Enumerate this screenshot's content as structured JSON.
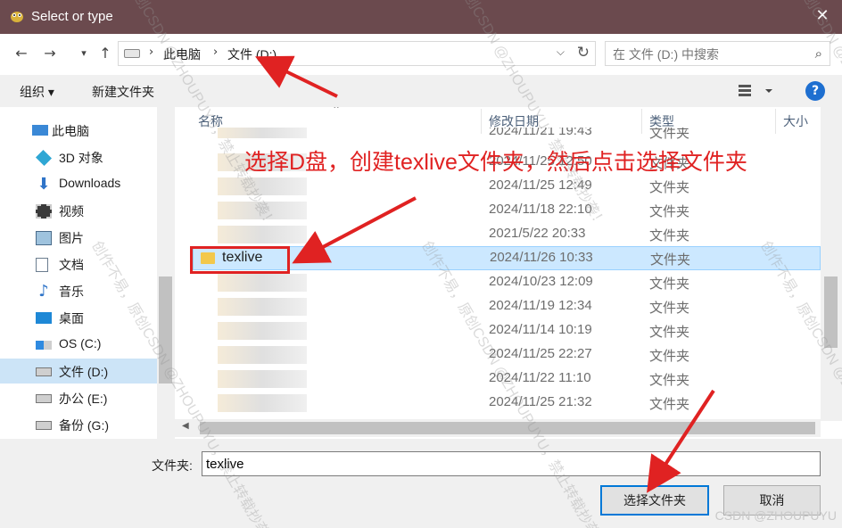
{
  "window": {
    "title": "Select or type",
    "close_glyph": "✕"
  },
  "nav": {
    "back_icon": "back-arrow-icon",
    "forward_icon": "forward-arrow-icon",
    "up_icon": "up-arrow-icon",
    "breadcrumb": [
      "此电脑",
      "文件 (D:)"
    ],
    "search_placeholder": "在 文件 (D:) 中搜索"
  },
  "toolbar": {
    "organize": "组织 ▾",
    "new_folder": "新建文件夹",
    "help": "?"
  },
  "sidebar": {
    "items": [
      {
        "label": "此电脑",
        "icon": "computer-icon"
      },
      {
        "label": "3D 对象",
        "icon": "cube-icon"
      },
      {
        "label": "Downloads",
        "icon": "download-icon"
      },
      {
        "label": "视频",
        "icon": "video-icon"
      },
      {
        "label": "图片",
        "icon": "picture-icon"
      },
      {
        "label": "文档",
        "icon": "document-icon"
      },
      {
        "label": "音乐",
        "icon": "music-icon"
      },
      {
        "label": "桌面",
        "icon": "desktop-icon"
      },
      {
        "label": "OS (C:)",
        "icon": "windows-drive-icon"
      },
      {
        "label": "文件 (D:)",
        "icon": "drive-icon"
      },
      {
        "label": "办公 (E:)",
        "icon": "drive-icon"
      },
      {
        "label": "备份 (G:)",
        "icon": "drive-icon"
      }
    ]
  },
  "columns": {
    "name": "名称",
    "modified": "修改日期",
    "type": "类型",
    "size": "大小"
  },
  "files": [
    {
      "name": "",
      "date": "2024/11/21 19:43",
      "type": "文件夹"
    },
    {
      "name": "",
      "date": "2024/11/25 12:50",
      "type": "文件夹"
    },
    {
      "name": "",
      "date": "2024/11/25 12:49",
      "type": "文件夹"
    },
    {
      "name": "",
      "date": "2024/11/18 22:10",
      "type": "文件夹"
    },
    {
      "name": "",
      "date": "2021/5/22 20:33",
      "type": "文件夹"
    },
    {
      "name": "texlive",
      "date": "2024/11/26 10:33",
      "type": "文件夹"
    },
    {
      "name": "",
      "date": "2024/10/23 12:09",
      "type": "文件夹"
    },
    {
      "name": "",
      "date": "2024/11/19 12:34",
      "type": "文件夹"
    },
    {
      "name": "",
      "date": "2024/11/14 10:19",
      "type": "文件夹"
    },
    {
      "name": "",
      "date": "2024/11/25 22:27",
      "type": "文件夹"
    },
    {
      "name": "",
      "date": "2024/11/22 11:10",
      "type": "文件夹"
    },
    {
      "name": "",
      "date": "2024/11/25 21:32",
      "type": "文件夹"
    }
  ],
  "bottom": {
    "folder_label": "文件夹:",
    "folder_value": "texlive",
    "select_button": "选择文件夹",
    "cancel_button": "取消"
  },
  "annotation": {
    "text": "选择D盘，创建texlive文件夹，然后点击选择文件夹",
    "color": "#e02222"
  },
  "watermark": {
    "text": "创作不易，原创CSDN @ZHOUPUYU，禁止转载抄袭！",
    "credit": "CSDN @ZHOUPUYU"
  }
}
